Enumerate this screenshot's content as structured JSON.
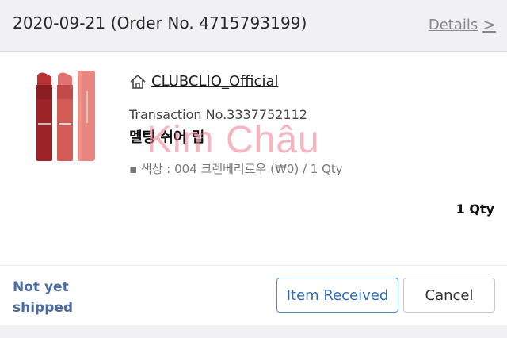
{
  "header": {
    "order_title": "2020-09-21 (Order No. 4715793199)",
    "details_label": "Details",
    "details_chevron": ">"
  },
  "order": {
    "shop_name": "CLUBCLIO_Official",
    "transaction": "Transaction No.3337752112",
    "product_name": "멜팅 쉬어 립",
    "option": "▪ 색상 : 004 크렌베리로우 (₩0) / 1 Qty",
    "quantity": "1 Qty",
    "watermark": "Kim Châu"
  },
  "status": {
    "shipping": "Not yet shipped"
  },
  "actions": {
    "received_label": "Item Received",
    "cancel_label": "Cancel"
  },
  "colors": {
    "accent_blue": "#2d6bb5",
    "status_blue": "#4a6aa0",
    "lipstick_dark": "#a3282c",
    "lipstick_coral": "#d65a57",
    "lipstick_pink": "#e6807c"
  },
  "icons": {
    "shop": "home-icon",
    "details": "chevron-right-icon"
  }
}
